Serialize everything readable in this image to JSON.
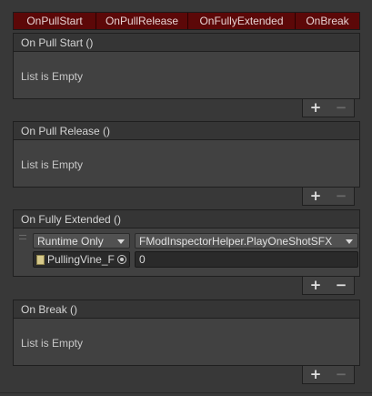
{
  "tabs": [
    {
      "label": "OnPullStart"
    },
    {
      "label": "OnPullRelease"
    },
    {
      "label": "OnFullyExtended"
    },
    {
      "label": "OnBreak"
    }
  ],
  "events": {
    "pull_start": {
      "title": "On Pull Start ()",
      "empty_text": "List is Empty"
    },
    "pull_release": {
      "title": "On Pull Release ()",
      "empty_text": "List is Empty"
    },
    "fully_extended": {
      "title": "On Fully Extended ()",
      "listener": {
        "call_state": "Runtime Only",
        "function": "FModInspectorHelper.PlayOneShotSFX",
        "target_object": "PullingVine_F",
        "argument": "0"
      }
    },
    "break": {
      "title": "On Break ()",
      "empty_text": "List is Empty"
    }
  },
  "footer": {
    "plus": "+",
    "minus": "−"
  },
  "colors": {
    "tab_background": "#5c0808",
    "panel_background": "#414141",
    "window_background": "#383838"
  }
}
